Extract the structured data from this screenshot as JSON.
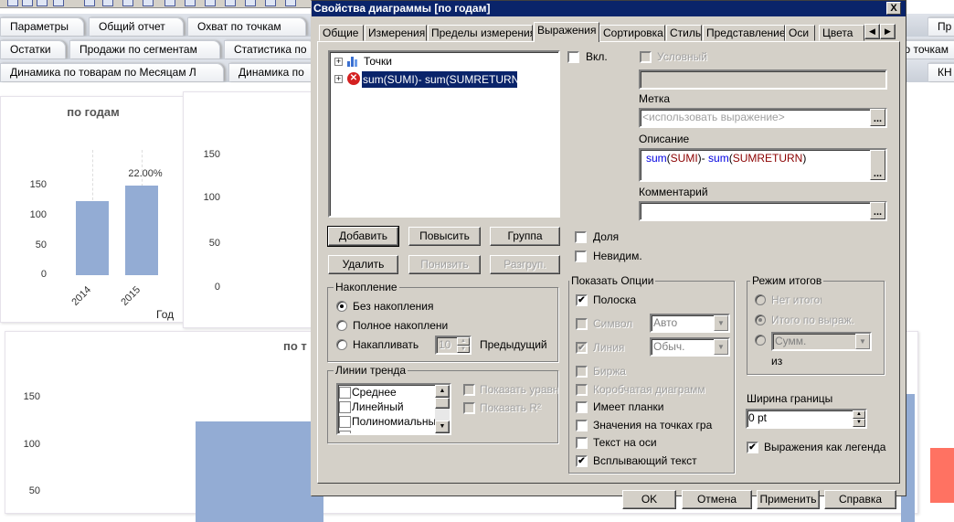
{
  "sheet_tabs": {
    "row1": [
      "Параметры",
      "Общий отчет",
      "Охват по точкам",
      "Пр"
    ],
    "row2": [
      "Остатки",
      "Продажи по сегментам",
      "Статистика по",
      "по точкам"
    ],
    "row3": [
      "Динамика по товарам по Месяцам Л",
      "Динамика по",
      "КН"
    ]
  },
  "chart_data": [
    {
      "type": "bar",
      "title": "по годам",
      "categories": [
        "2014",
        "2015"
      ],
      "values": [
        125,
        152
      ],
      "data_labels": [
        "",
        "22.00%"
      ],
      "xlabel": "Год",
      "ylabel": "",
      "yticks": [
        "0",
        "50",
        "100",
        "150"
      ],
      "ylim": [
        0,
        160
      ]
    },
    {
      "type": "bar",
      "title": "",
      "yticks": [
        "0",
        "50",
        "100",
        "150"
      ]
    },
    {
      "type": "bar",
      "title": "по т",
      "yticks": [
        "50",
        "100",
        "150"
      ]
    }
  ],
  "dialog": {
    "title": "Свойства диаграммы [по годам]",
    "close": "X",
    "tabs": [
      "Общие",
      "Измерения",
      "Пределы измерения",
      "Выражения",
      "Сортировка",
      "Стиль",
      "Представление",
      "Оси",
      "Цвета"
    ],
    "active_tab": "Выражения",
    "tree": {
      "items": [
        "Точки",
        "sum(SUMI)- sum(SUMRETURN)"
      ]
    },
    "buttons": {
      "add": "Добавить",
      "promote": "Повысить",
      "group": "Группа",
      "delete": "Удалить",
      "demote": "Понизить",
      "ungroup": "Разгруп."
    },
    "accumulation": {
      "title": "Накопление",
      "options": [
        "Без накопления",
        "Полное накоплени",
        "Накапливать"
      ],
      "selected": 0,
      "steps": "10",
      "previous": "Предыдущий"
    },
    "trendlines": {
      "title": "Линии тренда",
      "items": [
        "Среднее",
        "Линейный",
        "Полиномиальный"
      ],
      "show_equation": "Показать уравн",
      "show_r2": "Показать R²"
    },
    "enable": "Вкл.",
    "conditional": "Условный",
    "label": {
      "title": "Метка",
      "placeholder": "<использовать выражение>"
    },
    "description": {
      "title": "Описание",
      "fn1": "sum",
      "arg1": "SUMI",
      "mid": "- ",
      "fn2": "sum",
      "arg2": "SUMRETURN"
    },
    "comment": {
      "title": "Комментарий",
      "value": ""
    },
    "share": "Доля",
    "invisible": "Невидим.",
    "display_options": {
      "title": "Показать Опции",
      "bar": "Полоска",
      "symbol": "Символ",
      "symbol_value": "Авто",
      "line": "Линия",
      "line_value": "Обыч.",
      "stock": "Биржа",
      "box": "Коробчатая диаграмм",
      "error_bars": "Имеет планки",
      "values_on_points": "Значения на точках гра",
      "text_on_axis": "Текст на оси",
      "popup": "Всплывающий текст"
    },
    "totals": {
      "title": "Режим итогов",
      "none": "Нет итогов",
      "expr_total": "Итого по выраж.",
      "sum": "Сумм.",
      "of": "из"
    },
    "border_width": {
      "title": "Ширина границы",
      "value": "0 pt"
    },
    "expr_as_legend": "Выражения как легенда",
    "footer": [
      "OK",
      "Отмена",
      "Применить",
      "Справка"
    ],
    "ellipsis": "..."
  }
}
